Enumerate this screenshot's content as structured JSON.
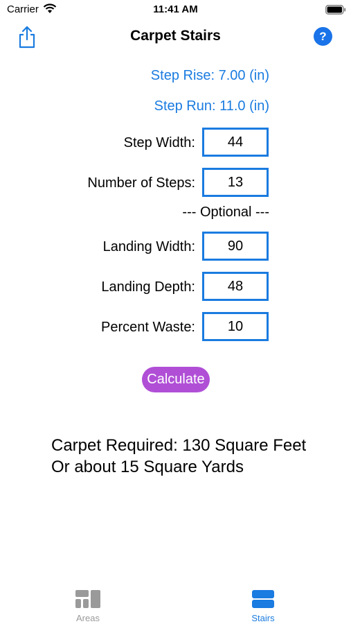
{
  "status_bar": {
    "carrier": "Carrier",
    "time": "11:41 AM"
  },
  "nav": {
    "title": "Carpet Stairs",
    "help_label": "?"
  },
  "links": {
    "step_rise": "Step Rise: 7.00 (in)",
    "step_run": "Step Run: 11.0 (in)"
  },
  "form": {
    "step_width": {
      "label": "Step Width:",
      "value": "44"
    },
    "number_of_steps": {
      "label": "Number of Steps:",
      "value": "13"
    },
    "optional_label": "--- Optional ---",
    "landing_width": {
      "label": "Landing Width:",
      "value": "90"
    },
    "landing_depth": {
      "label": "Landing Depth:",
      "value": "48"
    },
    "percent_waste": {
      "label": "Percent Waste:",
      "value": "10"
    }
  },
  "calculate_label": "Calculate",
  "result": {
    "line1": "Carpet Required: 130 Square Feet",
    "line2": "Or about 15 Square Yards"
  },
  "tabs": [
    {
      "label": "Areas",
      "icon": "grid-icon",
      "selected": false
    },
    {
      "label": "Stairs",
      "icon": "stairs-icon",
      "selected": true
    }
  ],
  "colors": {
    "accent": "#1a7be0",
    "calculate_button": "#b04fd6",
    "inactive_tab": "#9a9a9a"
  }
}
